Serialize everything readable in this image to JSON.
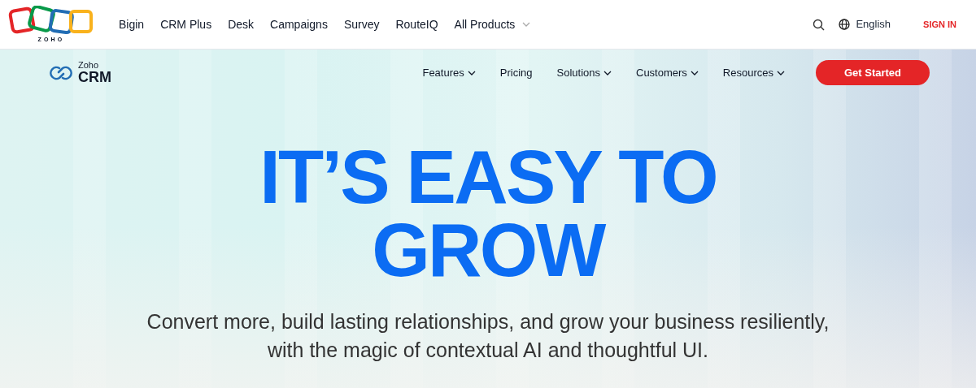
{
  "top_nav": {
    "logo_text": "ZOHO",
    "links": [
      {
        "label": "Bigin",
        "dropdown": false
      },
      {
        "label": "CRM Plus",
        "dropdown": false
      },
      {
        "label": "Desk",
        "dropdown": false
      },
      {
        "label": "Campaigns",
        "dropdown": false
      },
      {
        "label": "Survey",
        "dropdown": false
      },
      {
        "label": "RouteIQ",
        "dropdown": false
      },
      {
        "label": "All Products",
        "dropdown": true
      }
    ],
    "language": "English",
    "sign_in": "SIGN IN"
  },
  "product_nav": {
    "brand_small": "Zoho",
    "brand": "CRM",
    "items": [
      {
        "label": "Features",
        "dropdown": true
      },
      {
        "label": "Pricing",
        "dropdown": false
      },
      {
        "label": "Solutions",
        "dropdown": true
      },
      {
        "label": "Customers",
        "dropdown": true
      },
      {
        "label": "Resources",
        "dropdown": true
      }
    ],
    "cta": "Get Started"
  },
  "hero": {
    "headline_lines": [
      "IT’S EASY TO",
      "GROW"
    ],
    "subtitle_lines": [
      "Convert more, build lasting relationships, and grow your business resiliently,",
      "with the magic of contextual AI and thoughtful UI."
    ]
  }
}
